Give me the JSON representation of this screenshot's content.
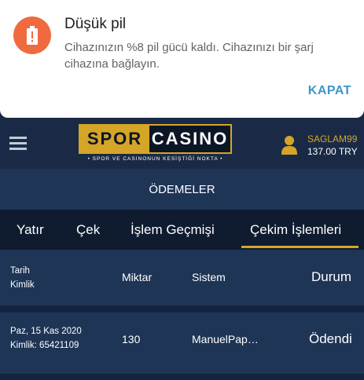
{
  "notification": {
    "title": "Düşük pil",
    "body": "Cihazınızın %8 pil gücü kaldı. Cihazınızı bir şarj cihazına bağlayın.",
    "action": "KAPAT",
    "icon": "battery-alert-icon",
    "accent_color": "#f06a3f",
    "action_color": "#3d96c8"
  },
  "header": {
    "logo": {
      "part1": "SPOR",
      "part2": "CASINO",
      "tagline": "• SPOR VE CASINONUN KESİŞTİĞİ NOKTA •"
    },
    "user": {
      "name": "SAGLAM99",
      "balance": "137.00 TRY"
    },
    "brand_color": "#d5a528"
  },
  "section_title": "ÖDEMELER",
  "tabs": [
    {
      "label": "Yatır"
    },
    {
      "label": "Çek"
    },
    {
      "label": "İşlem Geçmişi"
    },
    {
      "label": "Çekim İşlemleri",
      "active": true
    }
  ],
  "table": {
    "headers": {
      "date": "Tarih",
      "id": "Kimlik",
      "amount": "Miktar",
      "system": "Sistem",
      "status": "Durum"
    },
    "rows": [
      {
        "date": "Paz, 15 Kas 2020",
        "id": "Kimlik: 65421109",
        "amount": "130",
        "system": "ManuelPap…",
        "status": "Ödendi"
      }
    ]
  }
}
